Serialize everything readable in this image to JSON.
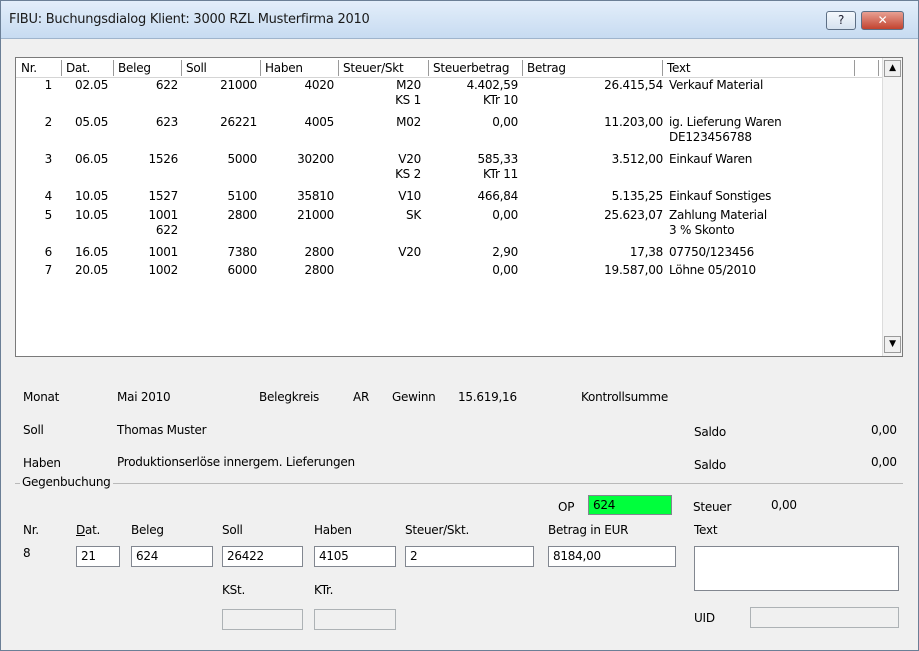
{
  "window": {
    "title": "FIBU: Buchungsdialog Klient: 3000  RZL Musterfirma  2010",
    "help_label": "?",
    "close_label": "✕"
  },
  "list": {
    "columns": [
      "Nr.",
      "Dat.",
      "Beleg",
      "Soll",
      "Haben",
      "Steuer/Skt",
      "Steuerbetrag",
      "Betrag",
      "Text"
    ],
    "rows": [
      {
        "nr": "1",
        "dat": "02.05",
        "beleg": "622",
        "beleg2": "",
        "soll": "21000",
        "haben": "4020",
        "steuer": "M20",
        "steuer2": "KS 1",
        "steuerbetrag": "4.402,59",
        "steuerbetrag2": "KTr 10",
        "betrag": "26.415,54",
        "text": "Verkauf Material",
        "text2": ""
      },
      {
        "nr": "2",
        "dat": "05.05",
        "beleg": "623",
        "beleg2": "",
        "soll": "26221",
        "haben": "4005",
        "steuer": "M02",
        "steuer2": "",
        "steuerbetrag": "0,00",
        "steuerbetrag2": "",
        "betrag": "11.203,00",
        "text": "ig. Lieferung Waren",
        "text2": "DE123456788"
      },
      {
        "nr": "3",
        "dat": "06.05",
        "beleg": "1526",
        "beleg2": "",
        "soll": "5000",
        "haben": "30200",
        "steuer": "V20",
        "steuer2": "KS 2",
        "steuerbetrag": "585,33",
        "steuerbetrag2": "KTr 11",
        "betrag": "3.512,00",
        "text": "Einkauf Waren",
        "text2": ""
      },
      {
        "nr": "4",
        "dat": "10.05",
        "beleg": "1527",
        "beleg2": "",
        "soll": "5100",
        "haben": "35810",
        "steuer": "V10",
        "steuer2": "",
        "steuerbetrag": "466,84",
        "steuerbetrag2": "",
        "betrag": "5.135,25",
        "text": "Einkauf Sonstiges",
        "text2": ""
      },
      {
        "nr": "5",
        "dat": "10.05",
        "beleg": "1001",
        "beleg2": "622",
        "soll": "2800",
        "haben": "21000",
        "steuer": "SK",
        "steuer2": "",
        "steuerbetrag": "0,00",
        "steuerbetrag2": "",
        "betrag": "25.623,07",
        "text": "Zahlung Material",
        "text2": "3 % Skonto"
      },
      {
        "nr": "6",
        "dat": "16.05",
        "beleg": "1001",
        "beleg2": "",
        "soll": "7380",
        "haben": "2800",
        "steuer": "V20",
        "steuer2": "",
        "steuerbetrag": "2,90",
        "steuerbetrag2": "",
        "betrag": "17,38",
        "text": "07750/123456",
        "text2": ""
      },
      {
        "nr": "7",
        "dat": "20.05",
        "beleg": "1002",
        "beleg2": "",
        "soll": "6000",
        "haben": "2800",
        "steuer": "",
        "steuer2": "",
        "steuerbetrag": "0,00",
        "steuerbetrag2": "",
        "betrag": "19.587,00",
        "text": "Löhne 05/2010",
        "text2": ""
      }
    ],
    "scroll_up": "▲",
    "scroll_down": "▼"
  },
  "info": {
    "monat_label": "Monat",
    "monat_value": "Mai 2010",
    "belegkreis_label": "Belegkreis",
    "belegkreis_value": "AR",
    "gewinn_label": "Gewinn",
    "gewinn_value": "15.619,16",
    "kontrollsumme_label": "Kontrollsumme",
    "soll_label": "Soll",
    "soll_value": "Thomas Muster",
    "haben_label": "Haben",
    "haben_value": "Produktionserlöse innergem. Lieferungen",
    "saldo_label": "Saldo",
    "saldo_soll": "0,00",
    "saldo_haben": "0,00"
  },
  "gegenbuchung": {
    "group_label": "Gegenbuchung",
    "op_label": "OP",
    "op_value": "624",
    "steuer_label": "Steuer",
    "steuer_value": "0,00",
    "nr_label": "Nr.",
    "nr_value": "8",
    "dat_label_u": "D",
    "dat_label_rest": "at.",
    "beleg_label": "Beleg",
    "soll_label": "Soll",
    "haben_label": "Haben",
    "steuer_skt_label": "Steuer/Skt.",
    "betrag_label": "Betrag in EUR",
    "text_label": "Text",
    "dat_value": "21",
    "beleg_value": "624",
    "soll_value": "26422",
    "haben_value": "4105",
    "steuer_skt_value": "2",
    "betrag_value": "8184,00",
    "text_value": "",
    "kst_label": "KSt.",
    "ktr_label": "KTr.",
    "kst_value": "",
    "ktr_value": "",
    "uid_label": "UID",
    "uid_value": ""
  }
}
